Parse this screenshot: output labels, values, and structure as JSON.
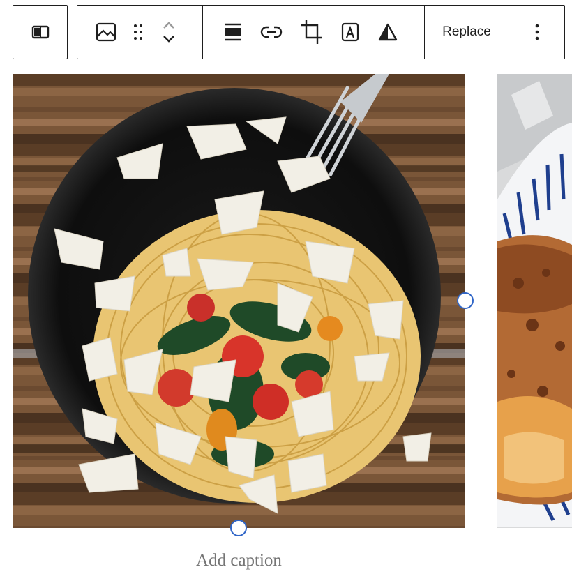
{
  "toolbar": {
    "groups": [
      {
        "name": "block-type",
        "buttons": [
          {
            "icon": "column-block-icon"
          }
        ]
      },
      {
        "name": "block-tools",
        "buttons": [
          {
            "icon": "image-icon"
          },
          {
            "icon": "drag-handle-icon"
          },
          {
            "icon": "chevron-up-icon"
          },
          {
            "icon": "chevron-down-icon"
          },
          {
            "icon": "align-icon"
          },
          {
            "icon": "link-icon"
          },
          {
            "icon": "crop-icon"
          },
          {
            "icon": "text-overlay-icon"
          },
          {
            "icon": "duotone-icon"
          }
        ]
      }
    ],
    "replace_label": "Replace",
    "more_icon": "more-vertical-icon"
  },
  "gallery": {
    "images": [
      {
        "subject": "spaghetti with tomatoes, spinach and parmesan on black plate"
      },
      {
        "subject": "toasted bread on striped plate"
      }
    ],
    "caption_placeholder": "Add caption"
  },
  "colors": {
    "accent": "#3066c8",
    "toolbar_border": "#1e1e1e",
    "caption_text": "#757575"
  }
}
